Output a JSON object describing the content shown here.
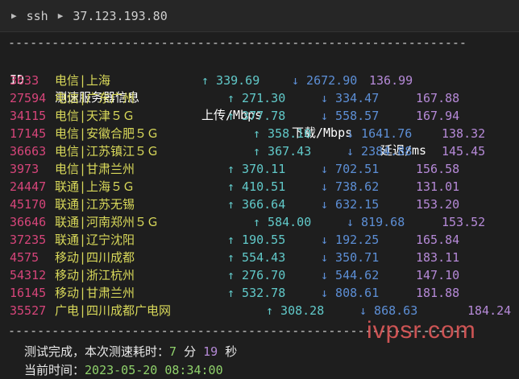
{
  "titlebar": {
    "app": "ssh",
    "host": "37.123.193.80"
  },
  "separator": "---------------------------------------------------------------",
  "headers": {
    "id": "ID",
    "server": "测速服务器信息",
    "upload": "上传/Mbps",
    "download": "下载/Mbps",
    "latency": "延迟/ms"
  },
  "rows": [
    {
      "id": "3633",
      "isp": "电信",
      "loc": "上海",
      "up": "↑ 339.69",
      "down": "↓ 2672.90",
      "lat": "136.99"
    },
    {
      "id": "27594",
      "isp": "电信",
      "loc": "广东广州",
      "up": "↑ 271.30",
      "down": "↓ 334.47",
      "lat": "167.88"
    },
    {
      "id": "34115",
      "isp": "电信",
      "loc": "天津５Ｇ",
      "up": "↑ 377.78",
      "down": "↓ 558.57",
      "lat": "167.94"
    },
    {
      "id": "17145",
      "isp": "电信",
      "loc": "安徽合肥５Ｇ",
      "up": "↑ 358.10",
      "down": "↓ 1641.76",
      "lat": "138.32"
    },
    {
      "id": "36663",
      "isp": "电信",
      "loc": "江苏镇江５Ｇ",
      "up": "↑ 367.43",
      "down": "↓ 2384.88",
      "lat": "145.45"
    },
    {
      "id": "3973",
      "isp": "电信",
      "loc": "甘肃兰州",
      "up": "↑ 370.11",
      "down": "↓ 702.51",
      "lat": "156.58"
    },
    {
      "id": "24447",
      "isp": "联通",
      "loc": "上海５Ｇ",
      "up": "↑ 410.51",
      "down": "↓ 738.62",
      "lat": "131.01"
    },
    {
      "id": "45170",
      "isp": "联通",
      "loc": "江苏无锡",
      "up": "↑ 366.64",
      "down": "↓ 632.15",
      "lat": "153.20"
    },
    {
      "id": "36646",
      "isp": "联通",
      "loc": "河南郑州５Ｇ",
      "up": "↑ 584.00",
      "down": "↓ 819.68",
      "lat": "153.52"
    },
    {
      "id": "37235",
      "isp": "联通",
      "loc": "辽宁沈阳",
      "up": "↑ 190.55",
      "down": "↓ 192.25",
      "lat": "165.84"
    },
    {
      "id": "4575",
      "isp": "移动",
      "loc": "四川成都",
      "up": "↑ 554.43",
      "down": "↓ 350.71",
      "lat": "183.11"
    },
    {
      "id": "54312",
      "isp": "移动",
      "loc": "浙江杭州",
      "up": "↑ 276.70",
      "down": "↓ 544.62",
      "lat": "147.10"
    },
    {
      "id": "16145",
      "isp": "移动",
      "loc": "甘肃兰州",
      "up": "↑ 532.78",
      "down": "↓ 808.61",
      "lat": "181.88"
    },
    {
      "id": "35527",
      "isp": "广电",
      "loc": "四川成都广电网",
      "up": "↑ 308.28",
      "down": "↓ 868.63",
      "lat": "184.24"
    }
  ],
  "summary": {
    "done_label": "测试完成，本次测速耗时：",
    "minutes": "7",
    "min_unit": "分",
    "seconds": "19",
    "sec_unit": "秒",
    "time_label": "当前时间：",
    "time_value": "2023-05-20 08:34:00"
  },
  "watermark": "ivpsr.com",
  "colors": {
    "id": "#d6457a",
    "isp": "#d9d95a",
    "up": "#61c9c9",
    "down": "#5d8fd6",
    "latency": "#b68ad8"
  }
}
